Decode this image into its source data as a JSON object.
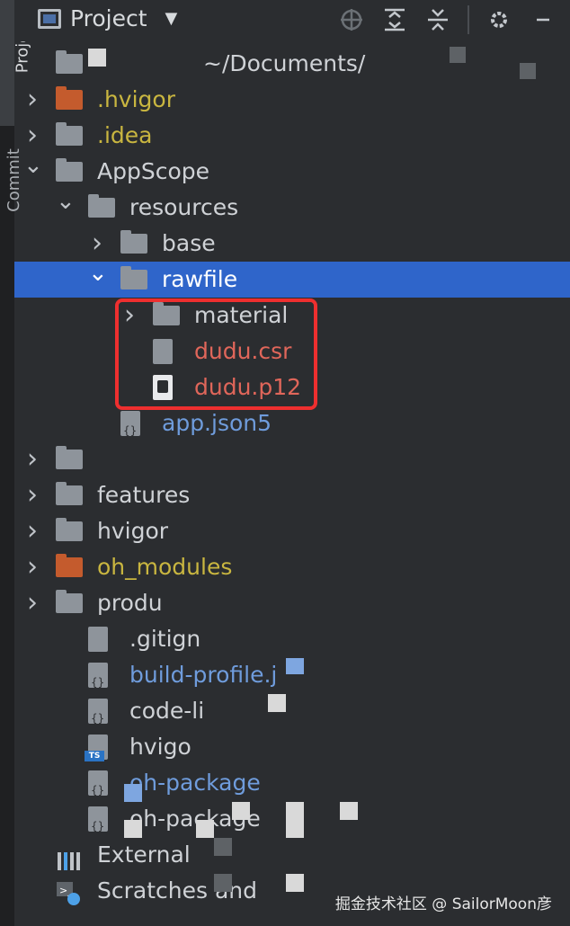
{
  "sidebar_strip": {
    "top_label": "Project",
    "second_label": "Commit"
  },
  "toolbar": {
    "title": "Project",
    "icons": [
      "locate-icon",
      "expand-all-icon",
      "collapse-all-icon",
      "gear-icon",
      "hide-icon"
    ]
  },
  "tree": [
    {
      "label": "~/Documents/",
      "type": "root",
      "indent": 0,
      "chevron": "",
      "color": "normal"
    },
    {
      "label": ".hvigor",
      "type": "folder-orange",
      "indent": 0,
      "chevron": ">",
      "color": "yellow"
    },
    {
      "label": ".idea",
      "type": "folder",
      "indent": 0,
      "chevron": ">",
      "color": "yellow"
    },
    {
      "label": "AppScope",
      "type": "folder",
      "indent": 0,
      "chevron": "v",
      "color": "normal"
    },
    {
      "label": "resources",
      "type": "folder",
      "indent": 1,
      "chevron": "v",
      "color": "normal"
    },
    {
      "label": "base",
      "type": "folder",
      "indent": 2,
      "chevron": ">",
      "color": "normal"
    },
    {
      "label": "rawfile",
      "type": "folder",
      "indent": 2,
      "chevron": "v",
      "color": "normal",
      "selected": true
    },
    {
      "label": "material",
      "type": "folder",
      "indent": 3,
      "chevron": ">",
      "color": "normal"
    },
    {
      "label": "dudu.csr",
      "type": "file",
      "indent": 3,
      "chevron": "",
      "color": "red"
    },
    {
      "label": "dudu.p12",
      "type": "file-cert",
      "indent": 3,
      "chevron": "",
      "color": "red"
    },
    {
      "label": "app.json5",
      "type": "file-json",
      "indent": 2,
      "chevron": "",
      "color": "blue"
    },
    {
      "label": "",
      "type": "folder",
      "indent": 0,
      "chevron": ">",
      "color": "normal"
    },
    {
      "label": "features",
      "type": "folder",
      "indent": 0,
      "chevron": ">",
      "color": "normal"
    },
    {
      "label": "hvigor",
      "type": "folder",
      "indent": 0,
      "chevron": ">",
      "color": "normal"
    },
    {
      "label": "oh_modules",
      "type": "folder-orange",
      "indent": 0,
      "chevron": ">",
      "color": "yellow"
    },
    {
      "label": "produ",
      "type": "folder",
      "indent": 0,
      "chevron": ">",
      "color": "normal"
    },
    {
      "label": ".gitign",
      "type": "file",
      "indent": 1,
      "chevron": "",
      "color": "normal"
    },
    {
      "label": "build-profile.j",
      "type": "file-json",
      "indent": 1,
      "chevron": "",
      "color": "blue"
    },
    {
      "label": "code-li",
      "type": "file-json",
      "indent": 1,
      "chevron": "",
      "color": "normal"
    },
    {
      "label": "hvigo",
      "type": "file-ts",
      "indent": 1,
      "chevron": "",
      "color": "normal"
    },
    {
      "label": "oh-package",
      "type": "file-json",
      "indent": 1,
      "chevron": "",
      "color": "blue"
    },
    {
      "label": "oh-package",
      "type": "file-json",
      "indent": 1,
      "chevron": "",
      "color": "normal"
    },
    {
      "label": "External",
      "type": "libraries",
      "indent": 0,
      "chevron": "",
      "color": "normal"
    },
    {
      "label": "Scratches and",
      "type": "scratches",
      "indent": 0,
      "chevron": "",
      "color": "normal"
    }
  ],
  "watermark": "掘金技术社区 @ SailorMoon彦"
}
